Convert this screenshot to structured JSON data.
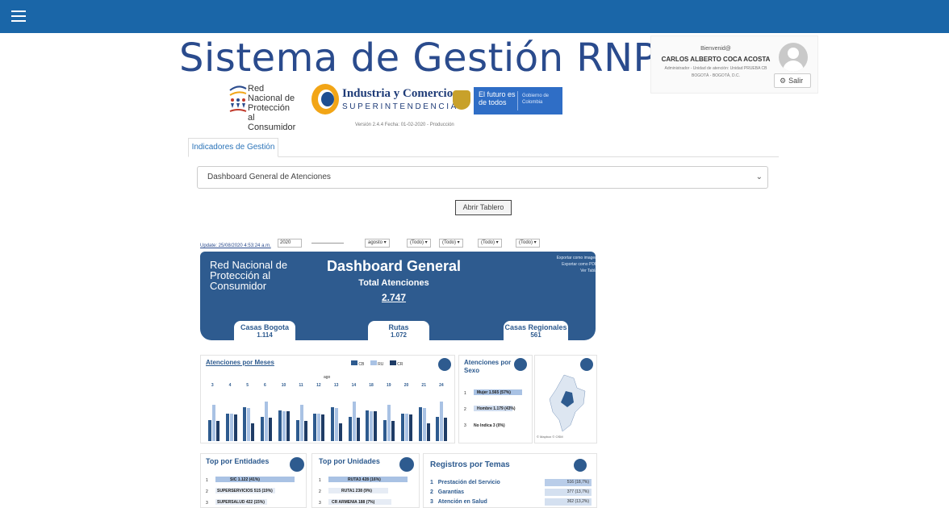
{
  "header": {
    "menu_icon": "menu-icon"
  },
  "app": {
    "title": "Sistema de Gestión RNPC",
    "version": "Versión 2.4.4 Fecha: 01-02-2020 - Producción"
  },
  "logos": {
    "rnpc": "Red Nacional de Protección al Consumidor",
    "sic_line1": "Industria y Comercio",
    "sic_line2": "SUPERINTENDENCIA",
    "gov_line1": "El futuro es de todos",
    "gov_line2": "Gobierno de Colombia"
  },
  "user": {
    "welcome": "Bienvenid@",
    "name": "CARLOS ALBERTO COCA ACOSTA",
    "role": "Administrador - Unidad de atención: Unidad PRUEBA CB",
    "city": "BOGOTÁ - BOGOTÁ, D.C.",
    "logout_label": "Salir"
  },
  "tabs": [
    {
      "label": "Indicadores de Gestión"
    }
  ],
  "select": {
    "value": "Dashboard General de Atenciones"
  },
  "open_button": "Abrir Tablero",
  "dashboard": {
    "update": "Update: 25/08/2020 4:53:24 a.m.",
    "year": "2020",
    "month": "agosto",
    "filters": [
      "(Todo)",
      "(Todo)",
      "(Todo)",
      "(Todo)"
    ],
    "rnpc": "Red Nacional de Protección al Consumidor",
    "title": "Dashboard General",
    "total_label": "Total Atenciones",
    "total_value": "2.747",
    "export_image": "Exportar como imagen",
    "export_pdf": "Exportar como PDF",
    "view_table": "Ver Tabla",
    "kpis": [
      {
        "label": "Casas Bogota",
        "value": "1.114"
      },
      {
        "label": "Rutas",
        "value": "1.072"
      },
      {
        "label": "Casas Regionales",
        "value": "561"
      }
    ],
    "months_title": "Atenciones por Meses",
    "legend": [
      "CB",
      "RU",
      "CR"
    ],
    "month_label": "ago",
    "days": [
      "3",
      "4",
      "5",
      "6",
      "10",
      "11",
      "12",
      "13",
      "14",
      "18",
      "19",
      "20",
      "21",
      "24"
    ],
    "sex_title": "Atenciones por Sexo",
    "sex": [
      {
        "idx": "1",
        "label": "Mujer 1.565 (57%)"
      },
      {
        "idx": "2",
        "label": "Hombre 1.179 (43%)"
      },
      {
        "idx": "3",
        "label": "No Indica 3 (0%)"
      }
    ],
    "map_credit": "© Mapbox © OSM",
    "entities_title": "Top por Entidades",
    "entities": [
      {
        "idx": "1",
        "label": "SIC 1.122 (41%)"
      },
      {
        "idx": "2",
        "label": "SUPERSERVICIOS 515 (19%)"
      },
      {
        "idx": "3",
        "label": "SUPERSALUD 422 (15%)"
      }
    ],
    "units_title": "Top por Unidades",
    "units": [
      {
        "idx": "1",
        "label": "RUTA3 428 (16%)"
      },
      {
        "idx": "2",
        "label": "RUTA1 238 (9%)"
      },
      {
        "idx": "3",
        "label": "CR ARMENIA 188 (7%)"
      }
    ],
    "topics_title": "Registros por Temas",
    "topics": [
      {
        "idx": "1",
        "label": "Prestación del Servicio",
        "value": "516 (18,7%)"
      },
      {
        "idx": "2",
        "label": "Garantías",
        "value": "377 (13,7%)"
      },
      {
        "idx": "3",
        "label": "Atención en Salud",
        "value": "362 (13,2%)"
      }
    ],
    "colors": {
      "cb": "#2e5b8f",
      "ru": "#a9c2e4",
      "cr": "#1f3c66"
    }
  }
}
